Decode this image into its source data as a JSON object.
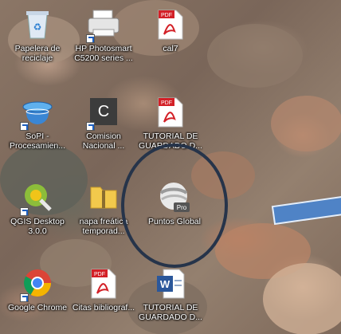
{
  "desktop": {
    "icons": [
      {
        "label": "Papelera de\nreciclaje",
        "icon": "recycle-bin-icon"
      },
      {
        "label": "HP Photosmart\nC5200 series ...",
        "icon": "printer-icon"
      },
      {
        "label": "cal7",
        "icon": "pdf-icon",
        "badge": "PDF"
      },
      {
        "label": "SoPI -\nProcesamien...",
        "icon": "sopi-icon"
      },
      {
        "label": "Comision\nNacional ...",
        "icon": "c-letter-icon",
        "letter": "C"
      },
      {
        "label": "TUTORIAL DE\nGUARDADO D...",
        "icon": "pdf-icon",
        "badge": "PDF"
      },
      {
        "label": "QGIS Desktop\n3.0.0",
        "icon": "qgis-icon"
      },
      {
        "label": "napa freática\ntemporad...",
        "icon": "zip-folder-icon"
      },
      {
        "label": "Puntos Global",
        "icon": "google-earth-pro-icon",
        "badge": "Pro"
      },
      {
        "label": "Google Chrome",
        "icon": "chrome-icon"
      },
      {
        "label": "Citas bibliograf...",
        "icon": "pdf-icon",
        "badge": "PDF"
      },
      {
        "label": "TUTORIAL DE\nGUARDADO D...",
        "icon": "word-icon",
        "badge": "W"
      }
    ]
  },
  "colors": {
    "annotation_circle": "#26344a",
    "annotation_arrow": "#4f83c6",
    "pdf_red": "#d32027",
    "word_blue": "#2b579a"
  }
}
